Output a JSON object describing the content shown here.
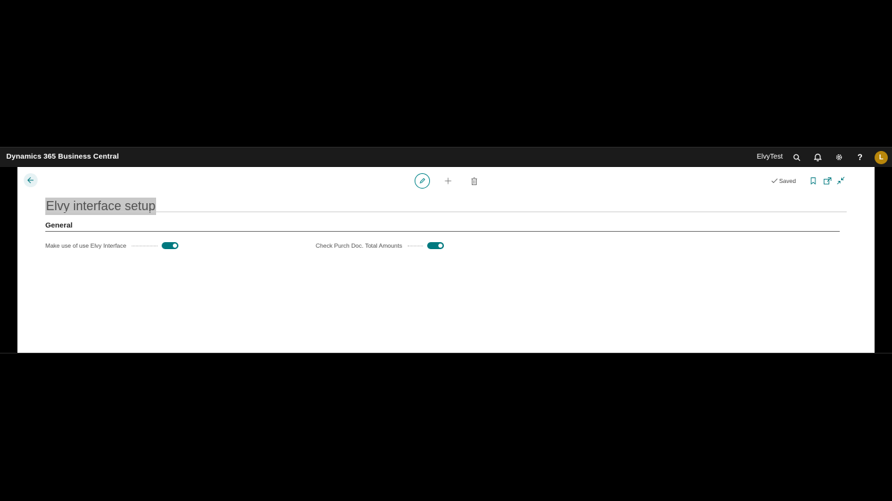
{
  "topbar": {
    "brand": "Dynamics 365 Business Central",
    "company": "ElvyTest",
    "avatar_initial": "L",
    "icons": [
      "search-icon",
      "bell-icon",
      "gear-icon",
      "help-icon"
    ]
  },
  "actions": {
    "icons": [
      "back-arrow-icon",
      "edit-pencil-icon",
      "plus-icon",
      "trash-icon",
      "bookmark-icon",
      "open-new-window-icon",
      "collapse-icon"
    ],
    "saved_label": "Saved"
  },
  "page": {
    "title": "Elvy interface setup",
    "section_title": "General",
    "fields": [
      {
        "label": "Make use of use Elvy Interface",
        "value": "on"
      },
      {
        "label": "Check Purch Doc. Total Amounts",
        "value": "on"
      }
    ]
  },
  "colors": {
    "accent": "#00797f",
    "topbar_bg": "#1b1b1b",
    "avatar_bg": "#b8860b",
    "title_highlight": "#c8c8c8"
  }
}
